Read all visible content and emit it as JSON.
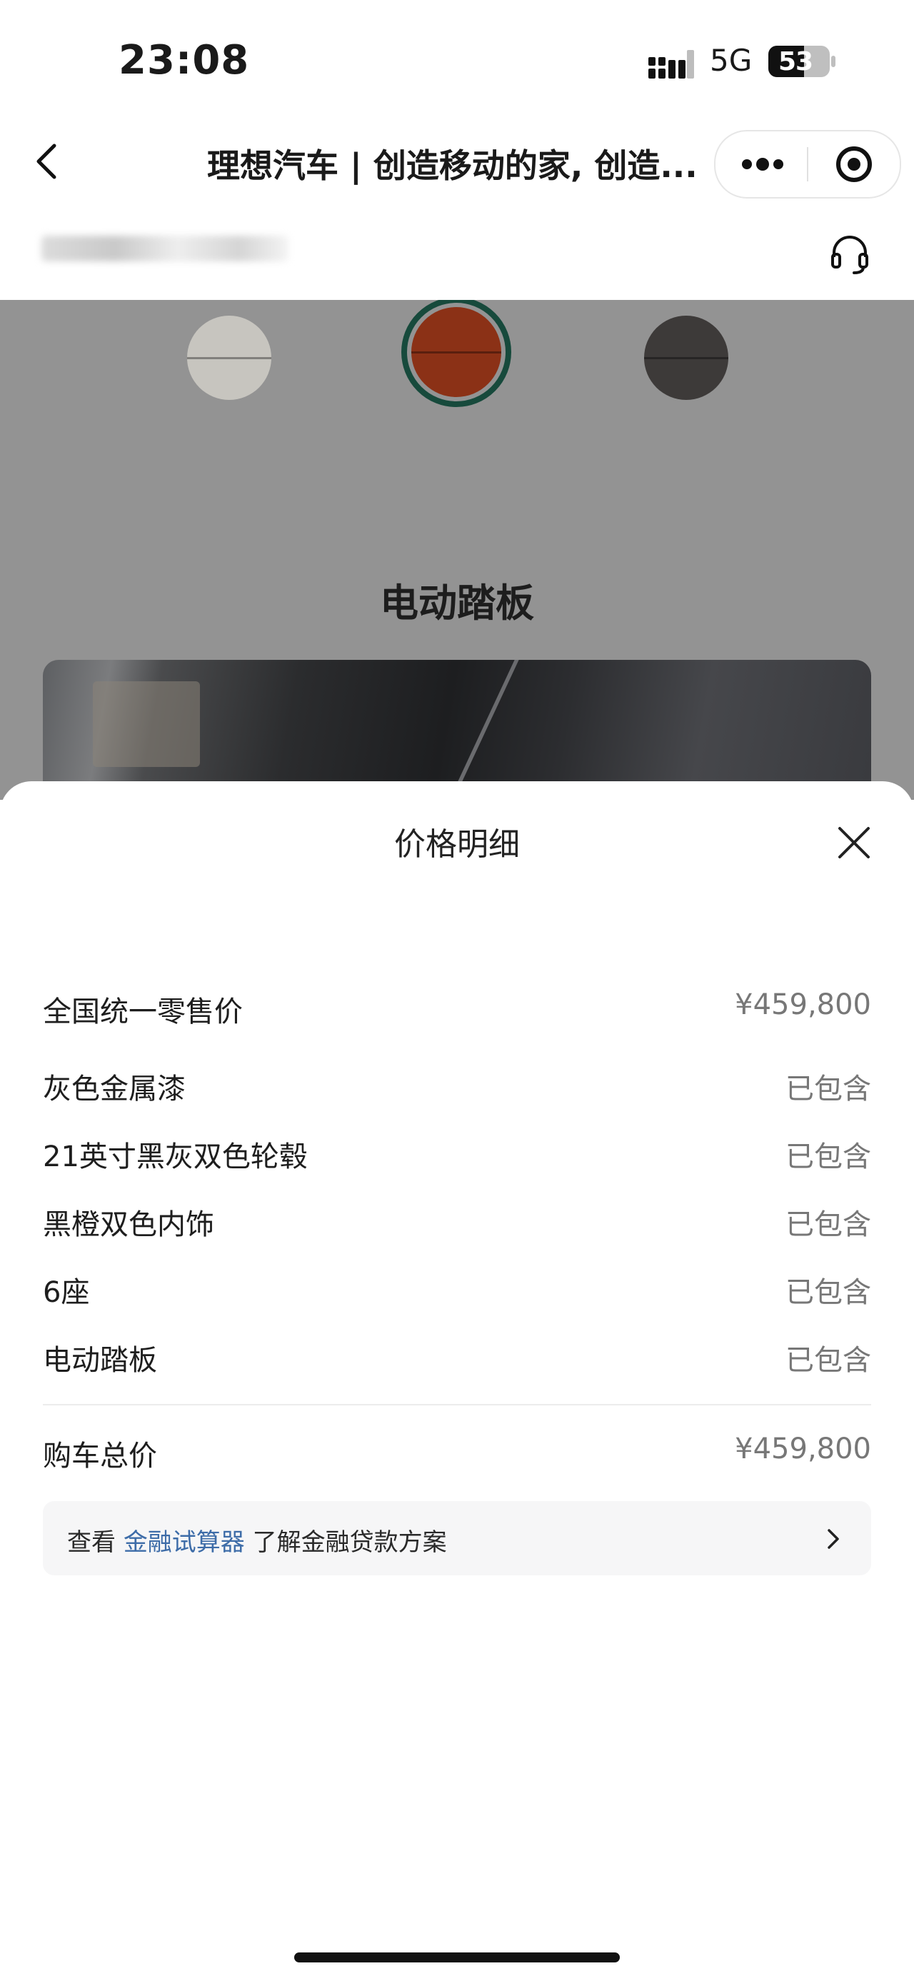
{
  "status_bar": {
    "time": "23:08",
    "network": "5G",
    "battery": "53"
  },
  "title_bar": {
    "title": "理想汽车 | 创造移动的家, 创造..."
  },
  "config": {
    "feature_title": "电动踏板",
    "swatches": [
      {
        "name": "light-gray",
        "color": "#c7c5bf"
      },
      {
        "name": "orange",
        "color": "#8b3116",
        "selected": true
      },
      {
        "name": "dark-gray",
        "color": "#3d3a39"
      }
    ]
  },
  "sheet": {
    "title": "价格明细",
    "items": [
      {
        "label": "全国统一零售价",
        "value": "¥459,800"
      },
      {
        "label": "灰色金属漆",
        "value": "已包含"
      },
      {
        "label": "21英寸黑灰双色轮毂",
        "value": "已包含"
      },
      {
        "label": "黑橙双色内饰",
        "value": "已包含"
      },
      {
        "label": "6座",
        "value": "已包含"
      },
      {
        "label": "电动踏板",
        "value": "已包含"
      }
    ],
    "total": {
      "label": "购车总价",
      "value": "¥459,800"
    },
    "finance": {
      "prefix": "查看",
      "link": "金融试算器",
      "suffix": "了解金融贷款方案"
    }
  }
}
